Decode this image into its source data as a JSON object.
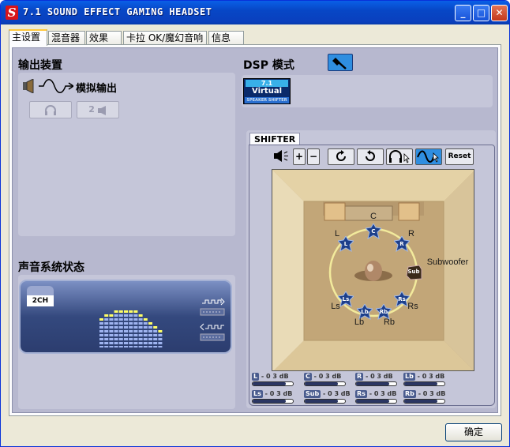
{
  "window": {
    "title": "7.1 SOUND EFFECT GAMING HEADSET",
    "icon": "S"
  },
  "titlebar": {
    "minimize": "_",
    "maximize": "□",
    "close": "✕"
  },
  "tabs": [
    "主设置",
    "混音器",
    "效果",
    "卡拉 OK/魔幻音响",
    "信息"
  ],
  "output": {
    "heading": "输出装置",
    "label": "模拟输出",
    "headphone_icon": "headphone-icon",
    "speaker_label": "2"
  },
  "status": {
    "heading": "声音系统状态",
    "channel": "2CH"
  },
  "dsp": {
    "heading": "DSP 模式",
    "logo_top": "7.1",
    "logo_mid": "Virtual",
    "logo_bottom": "SPEAKER SHIFTER"
  },
  "shifter": {
    "tab_label": "SHIFTER",
    "reset_label": "Reset",
    "speakers": [
      {
        "id": "C",
        "label": "C",
        "caption": "C"
      },
      {
        "id": "L",
        "label": "L",
        "caption": "L"
      },
      {
        "id": "R",
        "label": "R",
        "caption": "R"
      },
      {
        "id": "Sub",
        "label": "Sub",
        "caption": "Subwoofer"
      },
      {
        "id": "Ls",
        "label": "Ls",
        "caption": "Ls"
      },
      {
        "id": "Rs",
        "label": "Rs",
        "caption": "Rs"
      },
      {
        "id": "Lb",
        "label": "Lb",
        "caption": "Lb"
      },
      {
        "id": "Rb",
        "label": "Rb",
        "caption": "Rb"
      }
    ]
  },
  "meters": [
    {
      "badge": "L",
      "value": "- 0 3 dB",
      "level": 0.82
    },
    {
      "badge": "C",
      "value": "- 0 3 dB",
      "level": 0.82
    },
    {
      "badge": "R",
      "value": "- 0 3 dB",
      "level": 0.82
    },
    {
      "badge": "Lb",
      "value": "- 0 3 dB",
      "level": 0.82
    },
    {
      "badge": "Ls",
      "value": "- 0 3 dB",
      "level": 0.82
    },
    {
      "badge": "Sub",
      "value": "- 0 3 dB",
      "level": 0.82
    },
    {
      "badge": "Rs",
      "value": "- 0 3 dB",
      "level": 0.82
    },
    {
      "badge": "Rb",
      "value": "- 0 3 dB",
      "level": 0.82
    }
  ],
  "footer": {
    "ok_label": "确定"
  },
  "colors": {
    "titlebar": "#0a5fe6",
    "panel": "#b7b8cf",
    "status_bg": "#34497e",
    "eq_bar": "#ffff66"
  }
}
